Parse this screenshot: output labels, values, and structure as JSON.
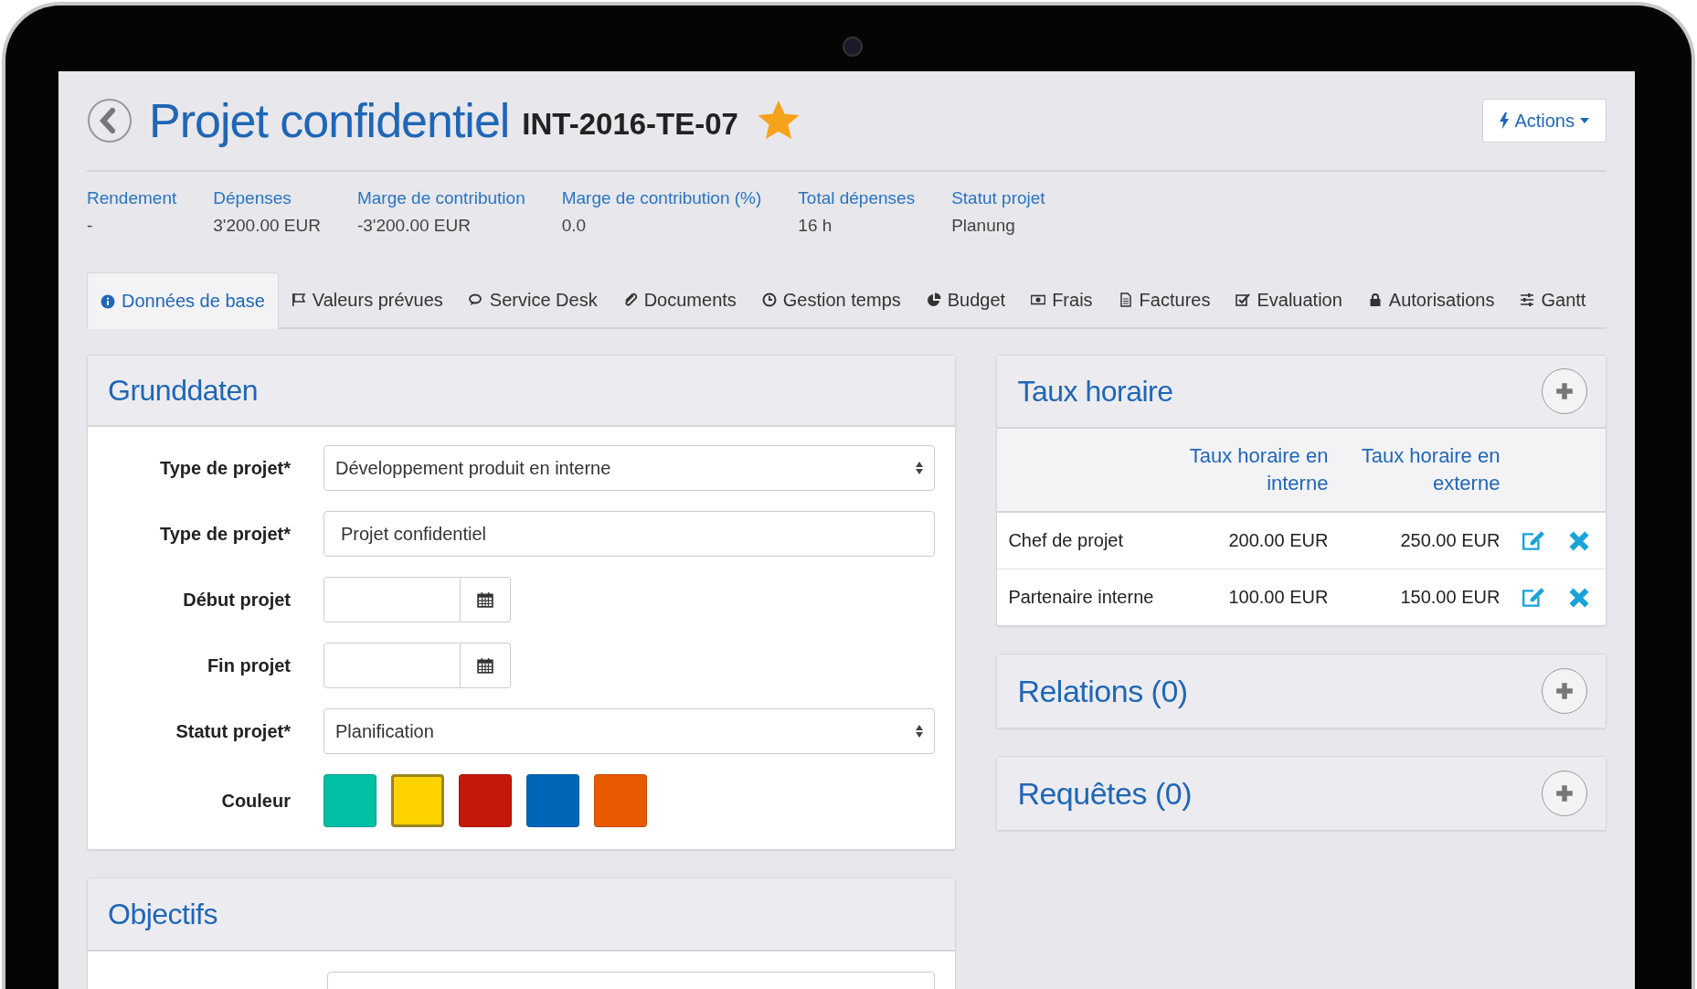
{
  "header": {
    "title": "Projet confidentiel",
    "code": "INT-2016-TE-07",
    "favorite": true,
    "actions_button": "Actions"
  },
  "metrics": [
    {
      "label": "Rendement",
      "value": "-"
    },
    {
      "label": "Dépenses",
      "value": "3'200.00 EUR"
    },
    {
      "label": "Marge de contribution",
      "value": "-3'200.00 EUR"
    },
    {
      "label": "Marge de contribution (%)",
      "value": "0.0"
    },
    {
      "label": "Total dépenses",
      "value": "16 h"
    },
    {
      "label": "Statut projet",
      "value": "Planung"
    }
  ],
  "tabs": [
    {
      "label": "Données de base",
      "selected": true
    },
    {
      "label": "Valeurs prévues",
      "selected": false
    },
    {
      "label": "Service Desk",
      "selected": false
    },
    {
      "label": "Documents",
      "selected": false
    },
    {
      "label": "Gestion temps",
      "selected": false
    },
    {
      "label": "Budget",
      "selected": false
    },
    {
      "label": "Frais",
      "selected": false
    },
    {
      "label": "Factures",
      "selected": false
    },
    {
      "label": "Evaluation",
      "selected": false
    },
    {
      "label": "Autorisations",
      "selected": false
    },
    {
      "label": "Gantt",
      "selected": false
    }
  ],
  "basic_panel": {
    "title": "Grunddaten",
    "fields": [
      {
        "kind": "select",
        "label": "Type de projet*",
        "value": "Développement produit en interne"
      },
      {
        "kind": "text",
        "label": "Type de projet*",
        "value": "Projet confidentiel"
      },
      {
        "kind": "date",
        "label": "Début projet"
      },
      {
        "kind": "date",
        "label": "Fin projet"
      },
      {
        "kind": "select",
        "label": "Statut projet*",
        "value": "Planification"
      },
      {
        "kind": "colors",
        "label": "Couleur",
        "colors": [
          {
            "color": "#00bfa5",
            "selected": false
          },
          {
            "color": "#ffd200",
            "selected": true
          },
          {
            "color": "#c4180a",
            "selected": false
          },
          {
            "color": "#0066b8",
            "selected": false
          },
          {
            "color": "#e85a00",
            "selected": false
          }
        ]
      }
    ]
  },
  "objectives_panel": {
    "title": "Objectifs"
  },
  "rates_panel": {
    "title": "Taux horaire",
    "columns": [
      "Taux horaire en interne",
      "Taux horaire en externe"
    ],
    "rows": [
      {
        "role": "Chef de projet",
        "internal": "200.00 EUR",
        "external": "250.00 EUR"
      },
      {
        "role": "Partenaire interne",
        "internal": "100.00 EUR",
        "external": "150.00 EUR"
      }
    ]
  },
  "side_panels": [
    {
      "title": "Relations (0)"
    },
    {
      "title": "Requêtes (0)"
    }
  ]
}
